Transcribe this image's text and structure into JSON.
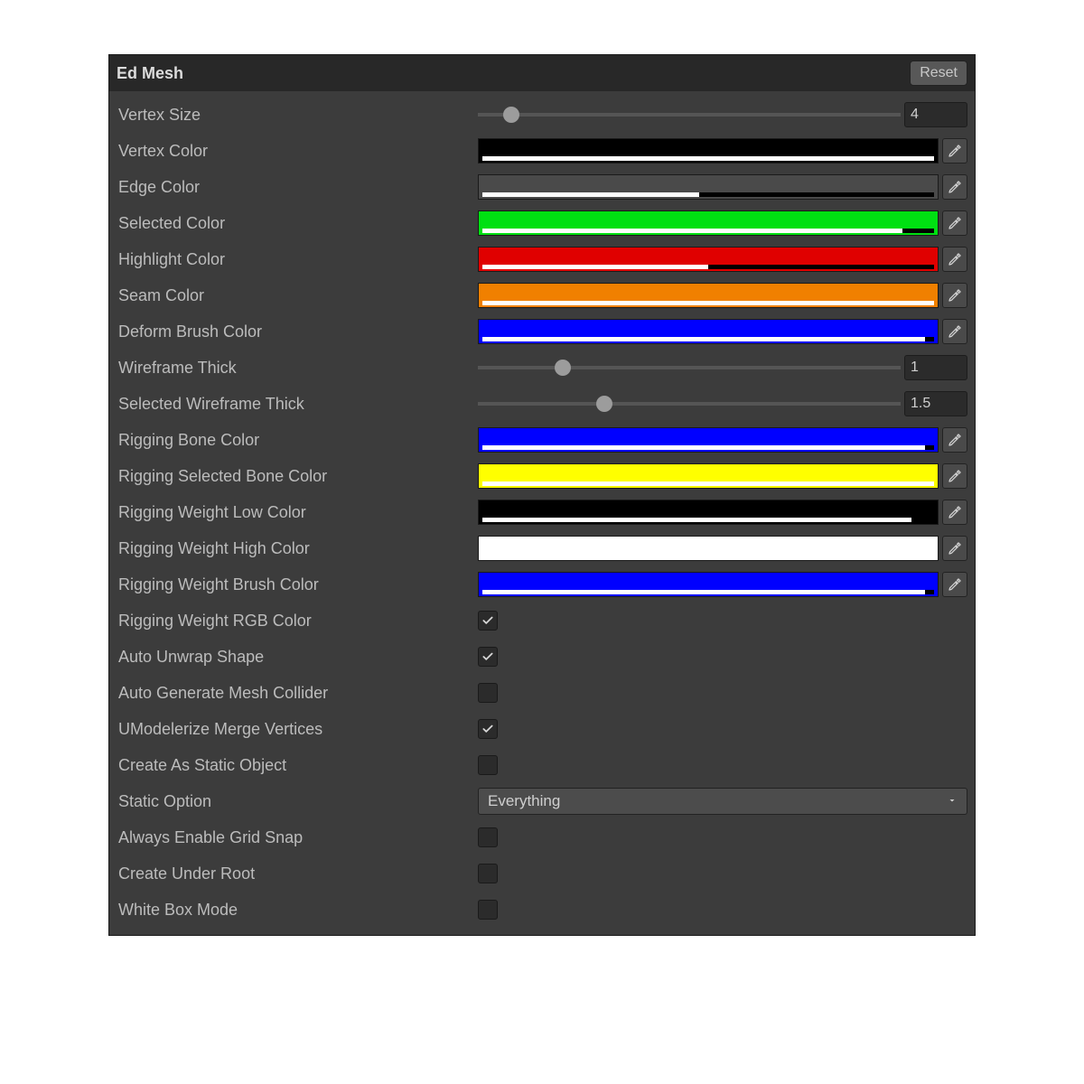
{
  "header": {
    "title": "Ed Mesh",
    "reset_label": "Reset"
  },
  "rows": {
    "vertex_size": {
      "label": "Vertex Size",
      "value": "4",
      "pct": 8
    },
    "vertex_color": {
      "label": "Vertex Color",
      "color": "#000000",
      "bar_white_pct": 100,
      "bar_black_pct": 0
    },
    "edge_color": {
      "label": "Edge Color",
      "color": "#4a4a4a",
      "bar_white_pct": 48,
      "bar_black_pct": 52
    },
    "selected_color": {
      "label": "Selected Color",
      "color": "#00e012",
      "bar_white_pct": 93,
      "bar_black_pct": 7
    },
    "highlight_color": {
      "label": "Highlight Color",
      "color": "#e00000",
      "bar_white_pct": 50,
      "bar_black_pct": 50
    },
    "seam_color": {
      "label": "Seam Color",
      "color": "#f08000",
      "bar_white_pct": 100,
      "bar_black_pct": 0
    },
    "deform_brush_color": {
      "label": "Deform Brush Color",
      "color": "#0000ff",
      "bar_white_pct": 98,
      "bar_black_pct": 2
    },
    "wireframe_thick": {
      "label": "Wireframe Thick",
      "value": "1",
      "pct": 20
    },
    "selected_wireframe_thick": {
      "label": "Selected Wireframe Thick",
      "value": "1.5",
      "pct": 30
    },
    "rigging_bone_color": {
      "label": "Rigging Bone Color",
      "color": "#0000ff",
      "bar_white_pct": 98,
      "bar_black_pct": 2
    },
    "rigging_selected_bone_color": {
      "label": "Rigging Selected Bone Color",
      "color": "#ffff00",
      "bar_white_pct": 100,
      "bar_black_pct": 0
    },
    "rigging_weight_low_color": {
      "label": "Rigging Weight Low Color",
      "color": "#000000",
      "bar_white_pct": 95,
      "bar_black_pct": 5
    },
    "rigging_weight_high_color": {
      "label": "Rigging Weight High Color",
      "color": "#ffffff",
      "bar_white_pct": 100,
      "bar_black_pct": 0
    },
    "rigging_weight_brush_color": {
      "label": "Rigging Weight Brush Color",
      "color": "#0000ff",
      "bar_white_pct": 98,
      "bar_black_pct": 2
    },
    "rigging_weight_rgb": {
      "label": "Rigging Weight RGB Color",
      "checked": true
    },
    "auto_unwrap_shape": {
      "label": "Auto Unwrap Shape",
      "checked": true
    },
    "auto_generate_mesh_collider": {
      "label": "Auto Generate Mesh Collider",
      "checked": false
    },
    "umodelerize_merge_vertices": {
      "label": "UModelerize Merge Vertices",
      "checked": true
    },
    "create_as_static_object": {
      "label": "Create As Static Object",
      "checked": false
    },
    "static_option": {
      "label": "Static Option",
      "value": "Everything"
    },
    "always_enable_grid_snap": {
      "label": "Always Enable Grid Snap",
      "checked": false
    },
    "create_under_root": {
      "label": "Create Under Root",
      "checked": false
    },
    "white_box_mode": {
      "label": "White Box Mode",
      "checked": false
    }
  }
}
